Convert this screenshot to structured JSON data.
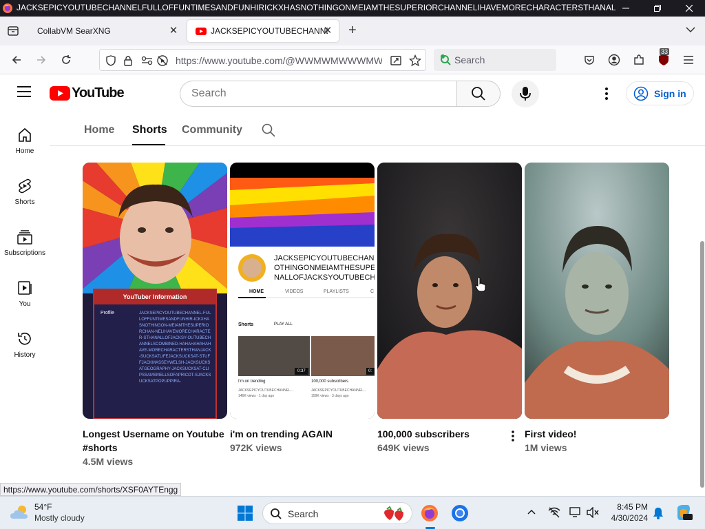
{
  "window": {
    "title": "JACKSEPICYOUTUBECHANNELFULLOFFUNTIMESANDFUNHIRICKXHASNOTHINGONMEIAMTHESUPERIORCHANNELIHAVEMORECHARACTERSTHANALLOFJACKSY..."
  },
  "tabs": [
    {
      "label": "CollabVM SearXNG"
    },
    {
      "label": "JACKSEPICYOUTUBECHANNEL"
    }
  ],
  "nav": {
    "url": "https://www.youtube.com/@WWMWMWWWMWWWMWM",
    "search_placeholder": "Search",
    "extension_badge": "33"
  },
  "yt": {
    "logo_text": "YouTube",
    "search_placeholder": "Search",
    "signin_label": "Sign in"
  },
  "sidebar": {
    "items": [
      {
        "label": "Home",
        "icon": "home-icon"
      },
      {
        "label": "Shorts",
        "icon": "shorts-icon"
      },
      {
        "label": "Subscriptions",
        "icon": "subscriptions-icon"
      },
      {
        "label": "You",
        "icon": "you-icon"
      },
      {
        "label": "History",
        "icon": "history-icon"
      }
    ]
  },
  "channel_tabs": [
    "Home",
    "Shorts",
    "Community"
  ],
  "shorts": [
    {
      "title": "Longest Username on Youtube #shorts",
      "views": "4.5M views",
      "thumb": {
        "banner": "YouTuber Information",
        "profile_label": "Profile",
        "profile_text": "JACKSEPICYOUTUBECHANNEL-FULLOFFUNTIMESANDFUNHIR-ICKXHASNOTHINGON-MEIAMTHESUPERIORCHAN-NELIHAVEMORECHARACTER-STHANALLOFJACKSY-OUTUBECHANNELSCOMBINED-HAHAHAHAHAHAVE-MORECHARACTERSTHANJACK-SUCKSATLIFEJACKSUCKSAT-STUFFJACKMASSEYWELSH-JACKSUCKSATGEOGRAPHY-JACKSUCKSAT-CLIPSSAMSMELLSOFAPRICOT-SJACKSUCKSATPOPUPPIRA-"
      }
    },
    {
      "title": "i'm on trending AGAIN",
      "views": "972K views",
      "thumb": {
        "channel_name": "JACKSEPICYOUTUBECHANN\nOTHINGONMEIAMTHESUPE\nNALLOFJACKSYOUTUBECH.",
        "tabs": [
          "HOME",
          "VIDEOS",
          "PLAYLISTS",
          "C"
        ],
        "shorts_label": "Shorts",
        "play_all": "PLAY ALL",
        "items": [
          {
            "duration": "0:37",
            "title": "I'm on trending",
            "channel": "JACKSEPICYOUTUBECHANNEL...",
            "meta": "146K views · 1 day ago"
          },
          {
            "duration": "0:",
            "title": "100,000 subscribers",
            "channel": "JACKSEPICYOUTUBECHANNEL...",
            "meta": "159K views · 3 days ago"
          }
        ]
      }
    },
    {
      "title": "100,000 subscribers",
      "views": "649K views"
    },
    {
      "title": "First video!",
      "views": "1M views"
    }
  ],
  "status_url": "https://www.youtube.com/shorts/XSF0AYTEngg",
  "taskbar": {
    "weather_temp": "54°F",
    "weather_desc": "Mostly cloudy",
    "search_placeholder": "Search",
    "time": "8:45 PM",
    "date": "4/30/2024"
  },
  "colors": {
    "yt_red": "#ff0000",
    "link_blue": "#065fd4"
  }
}
